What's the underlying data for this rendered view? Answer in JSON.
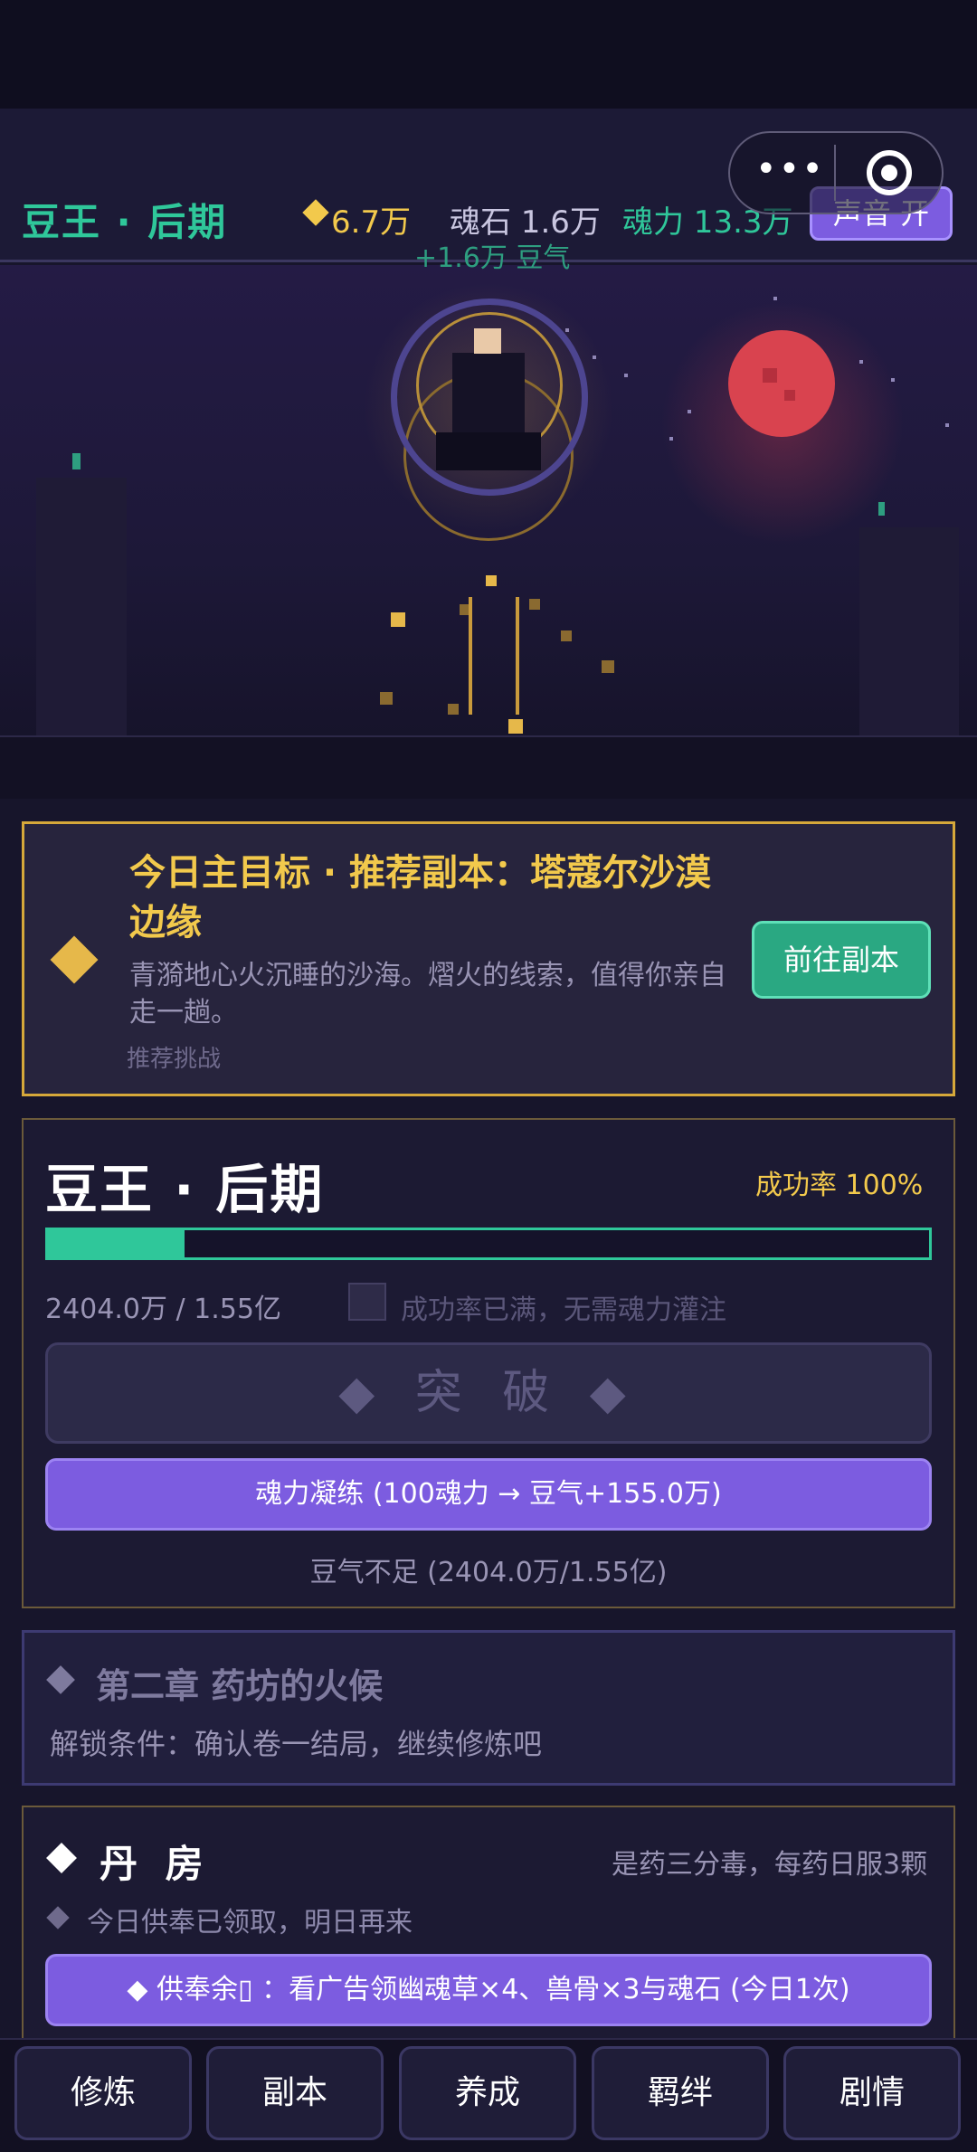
{
  "header": {
    "realm": "豆王 · 后期",
    "gold": "6.7万",
    "soulstone": "魂石 1.6万",
    "soulpower": "魂力 13.3万",
    "sound_toggle": "声音 开",
    "capsule_more": "•••"
  },
  "scene": {
    "gain": "+1.6万 豆气"
  },
  "quest": {
    "title": "今日主目标 · 推荐副本：塔蔻尔沙漠边缘",
    "description": "青漪地心火沉睡的沙海。熠火的线索，值得你亲自走一趟。",
    "tag": "推荐挑战",
    "button": "前往副本"
  },
  "breakthrough": {
    "realm": "豆王 · 后期",
    "success_rate": "成功率 100%",
    "progress_text": "2404.0万 / 1.55亿",
    "progress_fraction": 0.155,
    "check_label": "成功率已满，无需魂力灌注",
    "button": "◆ 突 破 ◆",
    "refine_button": "魂力凝练 (100魂力 → 豆气+155.0万)",
    "note": "豆气不足 (2404.0万/1.55亿)"
  },
  "chapter": {
    "title": "第二章 药坊的火候",
    "condition": "解锁条件：确认卷一结局，继续修炼吧"
  },
  "pharmacy": {
    "title": "丹 房",
    "hint": "是药三分毒，每药日服3颗",
    "status": "今日供奉已领取，明日再来",
    "button": "◆ 供奉余▯ ：看广告领幽魂草×4、兽骨×3与魂石 (今日1次)"
  },
  "nav": {
    "tabs": [
      "修炼",
      "副本",
      "养成",
      "羁绊",
      "剧情"
    ]
  },
  "colors": {
    "accent_green": "#2fc79a",
    "gold": "#f2c94c",
    "purple": "#7c5ce0",
    "moon_red": "#d9434f"
  }
}
